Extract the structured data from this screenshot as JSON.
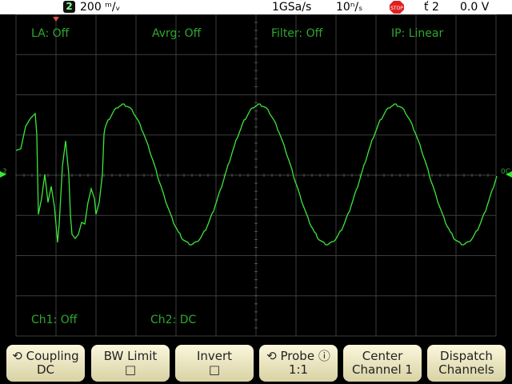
{
  "statusbar": {
    "channel_badge": "2",
    "volts_div": "200 ᵐ/ᵥ",
    "sample_rate": "1GSa/s",
    "time_div": "10ⁿ/ₛ",
    "run_state_icon": "stop-icon",
    "trigger": "ť 2",
    "trigger_level": "0.0 V"
  },
  "screen": {
    "labels": {
      "la": "LA: Off",
      "avrg": "Avrg: Off",
      "filter": "Filter: Off",
      "ip": "IP: Linear",
      "ch1": "Ch1: Off",
      "ch2": "Ch2: DC"
    },
    "channel_marker": "2",
    "trigger_marker_right": "0C"
  },
  "softkeys": [
    {
      "line1": "⟲ Coupling",
      "line2": "DC"
    },
    {
      "line1": "BW Limit",
      "line2": "□"
    },
    {
      "line1": "Invert",
      "line2": "□"
    },
    {
      "line1": "⟲ Probe ⓘ",
      "line2": "1:1"
    },
    {
      "line1": "Center",
      "line2": "Channel 1"
    },
    {
      "line1": "Dispatch",
      "line2": "Channels"
    }
  ],
  "colors": {
    "trace": "#3ce63c",
    "grid": "#3c3c3c",
    "label": "#2fa82f"
  }
}
